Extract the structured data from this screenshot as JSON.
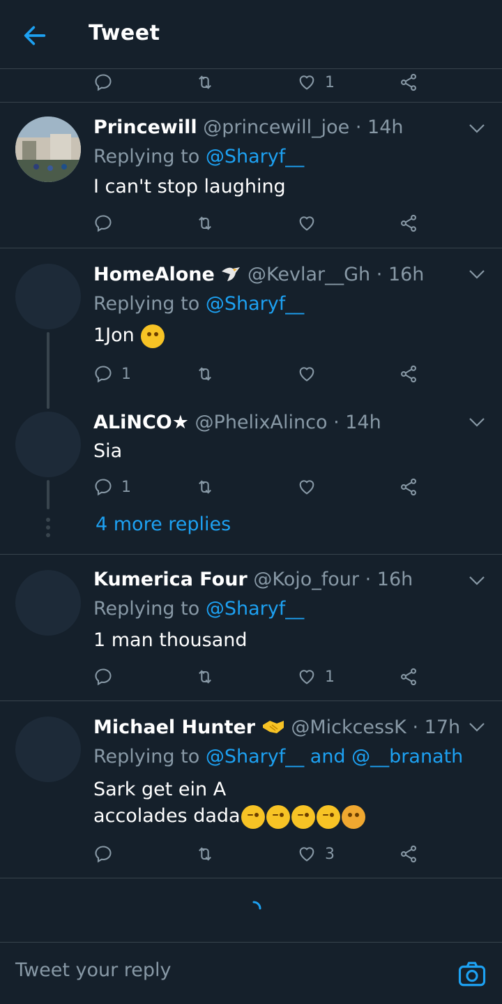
{
  "header": {
    "title": "Tweet"
  },
  "top_actions": {
    "like_count": "1"
  },
  "tweets": [
    {
      "name": "Princewill",
      "handle": "@princewill_joe",
      "time": "14h",
      "replying_prefix": "Replying to",
      "replying_to": "@Sharyf__",
      "text": "I can't stop laughing",
      "reply_count": "",
      "like_count": ""
    },
    {
      "name": "HomeAlone",
      "handle": "@Kevlar__Gh",
      "time": "16h",
      "replying_prefix": "Replying to",
      "replying_to": "@Sharyf__",
      "text": "1Jon",
      "reply_count": "1",
      "like_count": ""
    },
    {
      "name": "ALiNCO★",
      "handle": "@PhelixAlinco",
      "time": "14h",
      "text": "Sia",
      "reply_count": "1",
      "like_count": ""
    },
    {
      "name": "Kumerica Four",
      "handle": "@Kojo_four",
      "time": "16h",
      "replying_prefix": "Replying to",
      "replying_to": "@Sharyf__",
      "text": "1 man thousand",
      "reply_count": "",
      "like_count": "1"
    },
    {
      "name": "Michael Hunter",
      "handle": "@MickcessK",
      "time": "17h",
      "replying_prefix": "Replying to",
      "replying_to": "@Sharyf__ and @__branath",
      "text_line1": "Sark get ein A",
      "text_line2": "accolades dada",
      "reply_count": "",
      "like_count": "3"
    }
  ],
  "more_replies": "4 more replies",
  "reply_bar": {
    "placeholder": "Tweet your reply"
  },
  "colors": {
    "accent": "#1da1f2",
    "background": "#15202b",
    "muted": "#8899a6",
    "divider": "#38444d"
  }
}
